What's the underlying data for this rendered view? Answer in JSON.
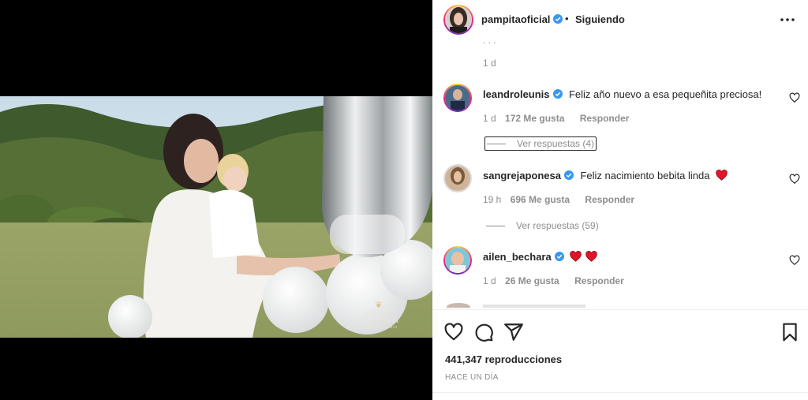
{
  "post": {
    "username": "pampitaoficial",
    "separator": "•",
    "follow_status": "Siguiendo",
    "more_icon": "more-horizontal-icon",
    "verified_color": "#3897f0"
  },
  "video": {
    "watermark_title": "GRAND PALLADIUM",
    "watermark_subtitle": "HOTELS & RESORTS"
  },
  "comments": {
    "top_partial": {
      "time": "1 d"
    },
    "items": [
      {
        "username": "leandroleunis",
        "text": "Feliz año nuevo a esa pequeñita preciosa!",
        "time": "1 d",
        "likes": "172 Me gusta",
        "reply_label": "Responder",
        "view_replies": "Ver respuestas (4)"
      },
      {
        "username": "sangrejaponesa",
        "text": "Feliz nacimiento bebita linda",
        "time": "19 h",
        "likes": "696 Me gusta",
        "reply_label": "Responder",
        "view_replies": "Ver respuestas (59)"
      },
      {
        "username": "ailen_bechara",
        "text": "",
        "time": "1 d",
        "likes": "26 Me gusta",
        "reply_label": "Responder"
      }
    ]
  },
  "actions": {
    "like_icon": "heart-icon",
    "comment_icon": "comment-icon",
    "share_icon": "share-icon",
    "save_icon": "bookmark-icon"
  },
  "stats": {
    "views": "441,347 reproducciones",
    "posted": "HACE UN DÍA"
  },
  "colors": {
    "heart_red": "#ed4956",
    "muted": "#8e8e8e",
    "text": "#262626"
  }
}
